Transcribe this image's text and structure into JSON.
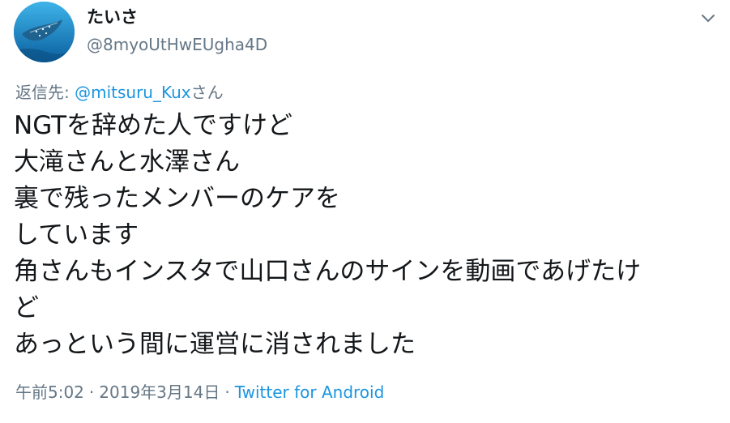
{
  "user": {
    "display_name": "たいさ",
    "handle": "@8myoUtHwEUgha4D"
  },
  "menu_icon": "chevron-down-icon",
  "reply": {
    "prefix": "返信先: ",
    "mention": "@mitsuru_Kux",
    "suffix": "さん"
  },
  "tweet": {
    "lines": [
      "NGTを辞めた人ですけど",
      "大滝さんと水澤さん",
      "裏で残ったメンバーのケアを",
      "しています",
      "角さんもインスタで山口さんのサインを動画であげたけ",
      "ど",
      "あっという間に運営に消されました"
    ]
  },
  "meta": {
    "time": "午前5:02",
    "separator": "·",
    "date": "2019年3月14日",
    "source": "Twitter for Android"
  },
  "colors": {
    "link": "#1b95e0",
    "secondary": "#657786",
    "text": "#14171a"
  }
}
